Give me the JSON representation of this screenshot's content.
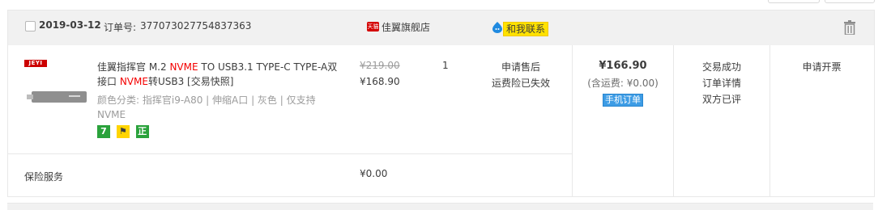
{
  "header": {
    "date": "2019-03-12",
    "order_label": "订单号:",
    "order_number": "377073027754837363",
    "tmall_badge": "天猫",
    "shop_name": "佳翼旗舰店",
    "contact_label": "和我联系"
  },
  "item": {
    "brand_logo": "JEYI",
    "title_parts": [
      "佳翼指挥官 M.2 ",
      "NVME",
      " TO USB3.1 TYPE-C TYPE-A双接口 ",
      "NVME",
      "转USB3 [交易快照]"
    ],
    "specs": "颜色分类: 指挥官i9-A80 | 伸缩A口 | 灰色 | 仅支持NVME",
    "badges": [
      "7",
      "⚑",
      "正"
    ],
    "original_price": "¥219.00",
    "price": "¥168.90",
    "quantity": "1",
    "after_sale": "申请售后",
    "insurance_status": "运费险已失效"
  },
  "payment": {
    "total": "¥166.90",
    "shipping": "(含运费: ¥0.00)",
    "mobile_order": "手机订单"
  },
  "status": {
    "line1": "交易成功",
    "line2": "订单详情",
    "line3": "双方已评"
  },
  "invoice": "申请开票",
  "insurance": {
    "label": "保险服务",
    "price": "¥0.00"
  },
  "colors": {
    "header_bg": "#f1f1f1",
    "red_text": "#f40000",
    "border": "#e8e8e8",
    "contact_bg": "#ffe200",
    "mobile_badge": "#3d9ce5"
  },
  "icons": {
    "checkbox": "checkbox-icon",
    "tmall": "tmall-icon",
    "wangwang": "wangwang-icon",
    "trash": "trash-icon"
  }
}
